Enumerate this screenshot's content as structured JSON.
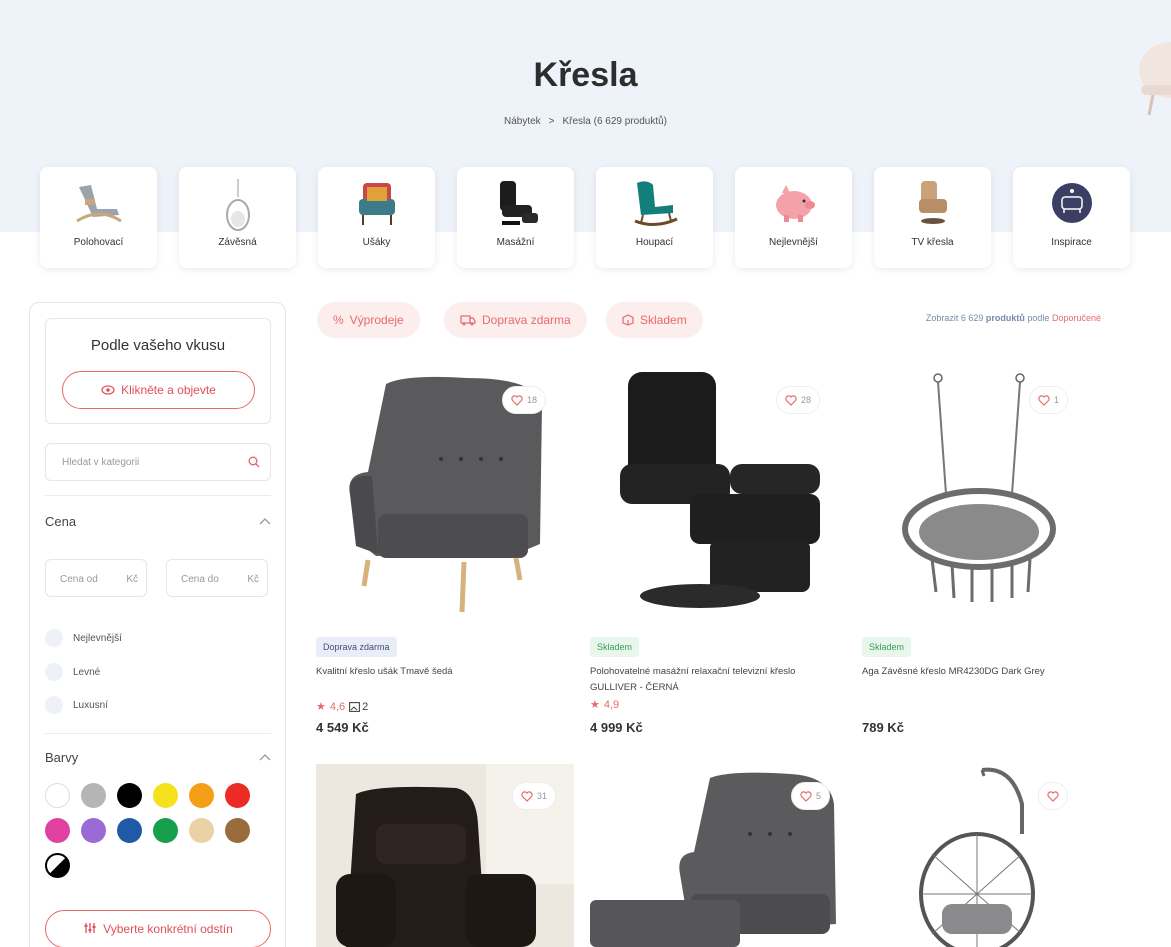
{
  "page": {
    "title": "Křesla",
    "breadcrumb": {
      "parent": "Nábytek",
      "separator": ">",
      "current": "Křesla (6 629 produktů)"
    }
  },
  "categories": [
    {
      "label": "Polohovací",
      "icon": "reclining-chair-icon"
    },
    {
      "label": "Závěsná",
      "icon": "hanging-chair-icon"
    },
    {
      "label": "Ušáky",
      "icon": "wingback-chair-icon"
    },
    {
      "label": "Masážní",
      "icon": "massage-chair-icon"
    },
    {
      "label": "Houpací",
      "icon": "rocking-chair-icon"
    },
    {
      "label": "Nejlevnější",
      "icon": "piggy-bank-icon"
    },
    {
      "label": "TV křesla",
      "icon": "tv-chair-icon"
    },
    {
      "label": "Inspirace",
      "icon": "inspiration-icon"
    }
  ],
  "sidebar": {
    "taste_title": "Podle vašeho vkusu",
    "taste_button": "Klikněte a objevte",
    "search_placeholder": "Hledat v kategorii",
    "price_title": "Cena",
    "price_from_placeholder": "Cena od",
    "price_to_placeholder": "Cena do",
    "currency": "Kč",
    "price_options": [
      "Nejlevnější",
      "Levné",
      "Luxusní"
    ],
    "colors_title": "Barvy",
    "colors": [
      "#ffffff",
      "#b5b5b5",
      "#000000",
      "#f5e11c",
      "#f59e17",
      "#eb2b24",
      "#e040a0",
      "#9a6ad6",
      "#1f5aa6",
      "#17a04b",
      "#ead1a6",
      "#9a6b3d",
      "mixed"
    ],
    "shade_button": "Vyberte konkrétní odstín"
  },
  "filters": {
    "chips": [
      {
        "label": "Výprodeje",
        "icon": "percent-icon"
      },
      {
        "label": "Doprava zdarma",
        "icon": "truck-icon"
      },
      {
        "label": "Skladem",
        "icon": "box-icon"
      }
    ],
    "sort_prefix": "Zobrazit 6 629",
    "sort_bold": "produktů",
    "sort_mid": "podle",
    "sort_value": "Doporučené"
  },
  "products": [
    {
      "likes": "18",
      "badge": "Doprava zdarma",
      "badge_type": "blue",
      "name": "Kvalitní křeslo ušák Tmavě šedá",
      "rating": "4,6",
      "images": "2",
      "price": "4 549 Kč"
    },
    {
      "likes": "28",
      "badge": "Skladem",
      "badge_type": "green",
      "name": "Polohovatelné masážní relaxační televizní křeslo GULLIVER - ČERNÁ",
      "rating": "4,9",
      "images": "",
      "price": "4 999 Kč"
    },
    {
      "likes": "1",
      "badge": "Skladem",
      "badge_type": "green",
      "name": "Aga Závěsné křeslo MR4230DG Dark Grey",
      "rating": "",
      "images": "",
      "price": "789 Kč"
    },
    {
      "likes": "31"
    },
    {
      "likes": "5"
    },
    {
      "likes": ""
    }
  ]
}
